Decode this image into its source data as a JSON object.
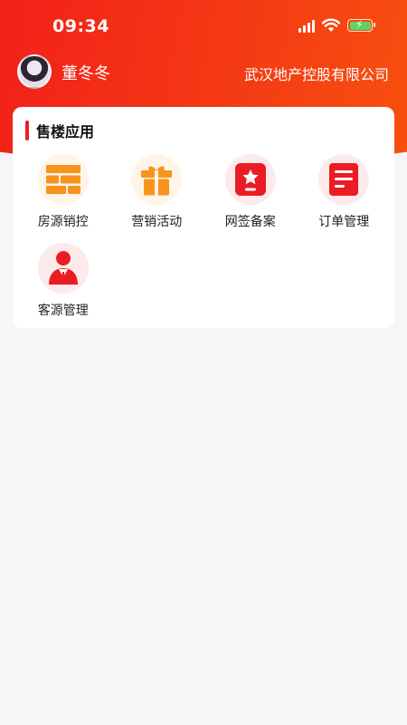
{
  "status_bar": {
    "time": "09:34"
  },
  "profile": {
    "name": "董冬冬",
    "company": "武汉地产控股有限公司"
  },
  "apps_section": {
    "title": "售楼应用",
    "items": [
      {
        "label": "房源销控",
        "icon": "brick-wall-icon"
      },
      {
        "label": "营销活动",
        "icon": "gift-icon"
      },
      {
        "label": "网签备案",
        "icon": "star-badge-icon"
      },
      {
        "label": "订单管理",
        "icon": "document-icon"
      },
      {
        "label": "客源管理",
        "icon": "customer-person-icon"
      }
    ]
  },
  "colors": {
    "accent": "#ee1e26",
    "header_gradient_start": "#f21a1a",
    "header_gradient_end": "#f7560d",
    "orange_icon": "#f7941d",
    "red_icon": "#ea1c24"
  }
}
